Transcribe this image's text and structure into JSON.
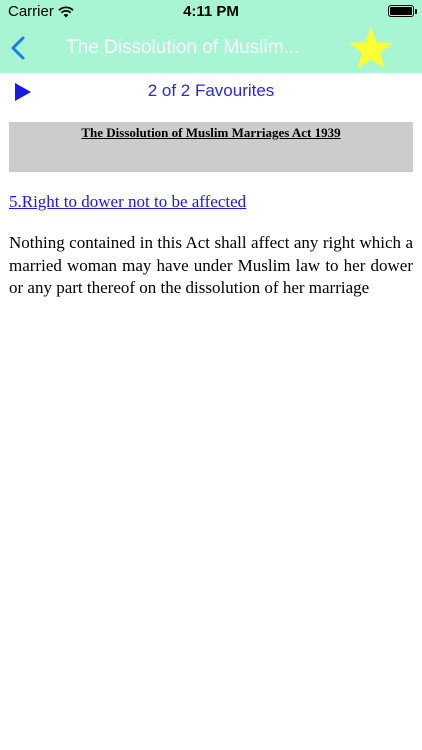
{
  "status_bar": {
    "carrier": "Carrier",
    "time": "4:11 PM"
  },
  "nav": {
    "title": "The Dissolution of Muslim...",
    "back_icon": "chevron-left-icon",
    "favourite_icon": "star-icon",
    "accent_color": "#a8f5d3",
    "star_color": "#ffff33"
  },
  "toolbar": {
    "play_icon": "play-icon",
    "favourites_label": "2 of 2 Favourites"
  },
  "document": {
    "act_title": "The Dissolution of Muslim Marriages Act 1939",
    "section_heading": "5.Right to dower not to be affected",
    "section_body": "Nothing contained in this Act shall affect any right which a married woman may have under Muslim law to her dower or any part thereof on the dissolution of her marriage"
  }
}
